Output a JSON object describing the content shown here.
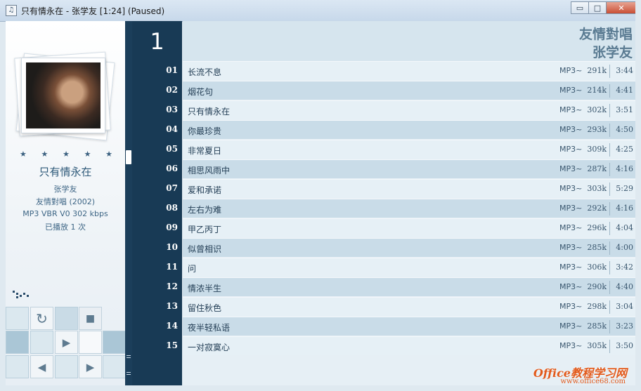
{
  "window": {
    "title": "只有情永在 - 张学友 [1:24] (Paused)",
    "app_icon": "♫",
    "min": "▭",
    "max": "□",
    "close": "✕"
  },
  "now_playing": {
    "rating_stars": "★★★★★",
    "title": "只有情永在",
    "artist": "张学友",
    "album_line": "友情對唱 (2002)",
    "format_line": "MP3  VBR V0  302 kbps",
    "play_count": "已播放 1 次"
  },
  "controls": {
    "repeat_icon": "↻",
    "stop_icon": "■",
    "play_icon": "▶",
    "prev_icon": "◀",
    "next_icon": "▶"
  },
  "disc": {
    "number": "1"
  },
  "album_header": {
    "album": "友情對唱",
    "artist": "张学友"
  },
  "tracks": [
    {
      "no": "01",
      "title": "长流不息",
      "fmt": "MP3~",
      "br": "291k",
      "dur": "3:44"
    },
    {
      "no": "02",
      "title": "烟花句",
      "fmt": "MP3~",
      "br": "214k",
      "dur": "4:41"
    },
    {
      "no": "03",
      "title": "只有情永在",
      "fmt": "MP3~",
      "br": "302k",
      "dur": "3:51"
    },
    {
      "no": "04",
      "title": "你最珍贵",
      "fmt": "MP3~",
      "br": "293k",
      "dur": "4:50"
    },
    {
      "no": "05",
      "title": "非常夏日",
      "fmt": "MP3~",
      "br": "309k",
      "dur": "4:25"
    },
    {
      "no": "06",
      "title": "相思风雨中",
      "fmt": "MP3~",
      "br": "287k",
      "dur": "4:16"
    },
    {
      "no": "07",
      "title": "爱和承诺",
      "fmt": "MP3~",
      "br": "303k",
      "dur": "5:29"
    },
    {
      "no": "08",
      "title": "左右为难",
      "fmt": "MP3~",
      "br": "292k",
      "dur": "4:16"
    },
    {
      "no": "09",
      "title": "甲乙丙丁",
      "fmt": "MP3~",
      "br": "296k",
      "dur": "4:04"
    },
    {
      "no": "10",
      "title": "似曾相识",
      "fmt": "MP3~",
      "br": "285k",
      "dur": "4:00"
    },
    {
      "no": "11",
      "title": "问",
      "fmt": "MP3~",
      "br": "306k",
      "dur": "3:42"
    },
    {
      "no": "12",
      "title": "情浓半生",
      "fmt": "MP3~",
      "br": "290k",
      "dur": "4:40"
    },
    {
      "no": "13",
      "title": "留住秋色",
      "fmt": "MP3~",
      "br": "298k",
      "dur": "3:04"
    },
    {
      "no": "14",
      "title": "夜半轻私语",
      "fmt": "MP3~",
      "br": "285k",
      "dur": "3:23"
    },
    {
      "no": "15",
      "title": "一对寂寞心",
      "fmt": "MP3~",
      "br": "305k",
      "dur": "3:50"
    }
  ],
  "watermark": {
    "brand": "Office教程学习网",
    "url": "www.office68.com"
  }
}
